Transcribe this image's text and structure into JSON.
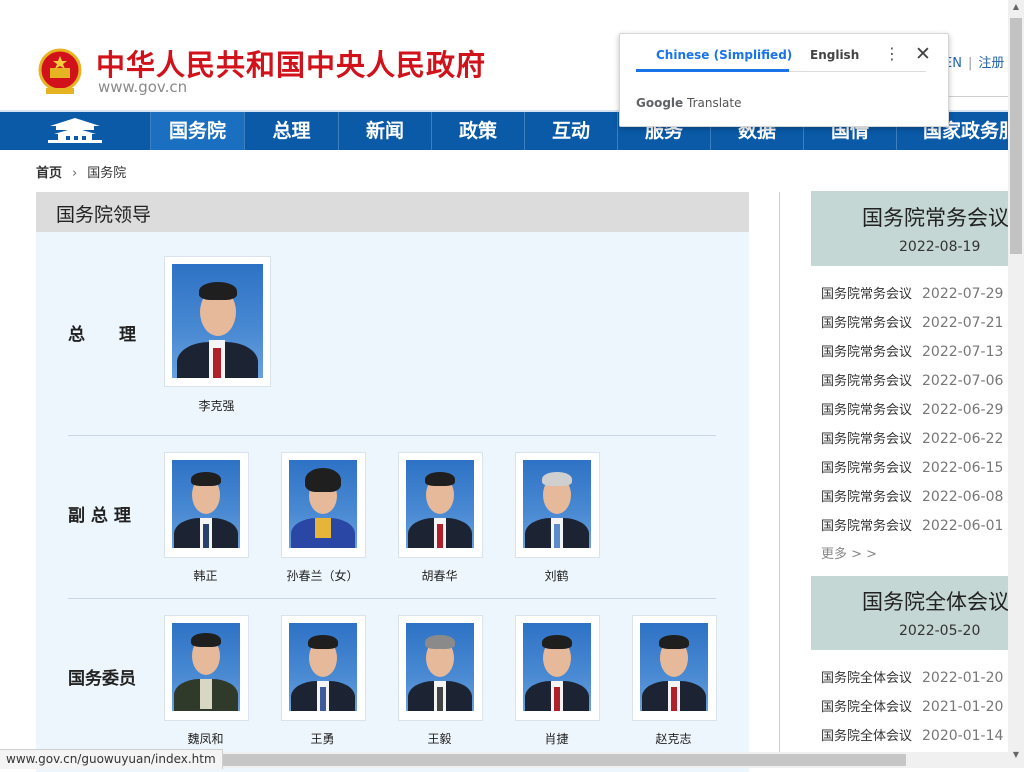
{
  "header": {
    "site_title": "中华人民共和国中央人民政府",
    "site_url": "www.gov.cn",
    "link_en": "EN",
    "link_register": "注册"
  },
  "nav": {
    "items": [
      "国务院",
      "总理",
      "新闻",
      "政策",
      "互动",
      "服务",
      "数据",
      "国情",
      "国家政务服"
    ],
    "active": "国务院"
  },
  "breadcrumb": {
    "home": "首页",
    "current": "国务院"
  },
  "leaders": {
    "title": "国务院领导",
    "premier": {
      "role": "总　　理",
      "names": [
        "李克强"
      ]
    },
    "vice": {
      "role": "副 总 理",
      "names": [
        "韩正",
        "孙春兰（女）",
        "胡春华",
        "刘鹤"
      ]
    },
    "councilors": {
      "role": "国务委员",
      "names": [
        "魏凤和",
        "王勇",
        "王毅",
        "肖捷",
        "赵克志"
      ]
    }
  },
  "right": {
    "executive": {
      "title": "国务院常务会议",
      "date": "2022-08-19",
      "rows": [
        {
          "title": "国务院常务会议",
          "date": "2022-07-29"
        },
        {
          "title": "国务院常务会议",
          "date": "2022-07-21"
        },
        {
          "title": "国务院常务会议",
          "date": "2022-07-13"
        },
        {
          "title": "国务院常务会议",
          "date": "2022-07-06"
        },
        {
          "title": "国务院常务会议",
          "date": "2022-06-29"
        },
        {
          "title": "国务院常务会议",
          "date": "2022-06-22"
        },
        {
          "title": "国务院常务会议",
          "date": "2022-06-15"
        },
        {
          "title": "国务院常务会议",
          "date": "2022-06-08"
        },
        {
          "title": "国务院常务会议",
          "date": "2022-06-01"
        }
      ],
      "more": "更多 > >"
    },
    "plenary": {
      "title": "国务院全体会议",
      "date": "2022-05-20",
      "rows": [
        {
          "title": "国务院全体会议",
          "date": "2022-01-20"
        },
        {
          "title": "国务院全体会议",
          "date": "2021-01-20"
        },
        {
          "title": "国务院全体会议",
          "date": "2020-01-14"
        }
      ]
    }
  },
  "translate": {
    "lang_source": "Chinese (Simplified)",
    "lang_target": "English",
    "brand_google": "Google",
    "brand_translate": "Translate",
    "menu_icon": "more-vert-icon",
    "close_icon": "close-icon"
  },
  "status_bar": {
    "url": "www.gov.cn/guowuyuan/index.htm"
  },
  "colors": {
    "brand_red": "#d1121a",
    "nav_blue": "#0a5aa8",
    "nav_active": "#1b6fc0",
    "panel_bg": "#eef6fd",
    "right_box": "#c5d7d4",
    "google_blue": "#1a73e8"
  }
}
